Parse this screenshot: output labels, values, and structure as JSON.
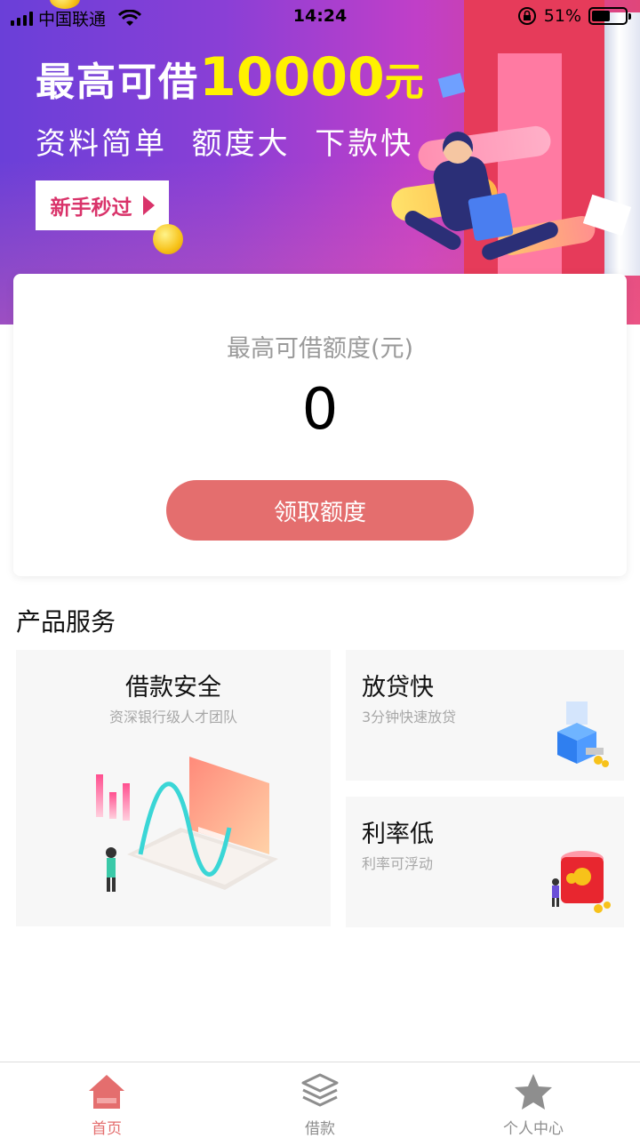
{
  "status_bar": {
    "carrier": "中国联通",
    "time": "14:24",
    "battery": "51%"
  },
  "banner": {
    "title_prefix": "最高可借",
    "title_amount": "10000",
    "title_suffix": "元",
    "subtitle": "资料简单  额度大  下款快",
    "cta_label": "新手秒过"
  },
  "quota_card": {
    "label": "最高可借额度(元)",
    "value": "0",
    "button_label": "领取额度"
  },
  "services": {
    "section_title": "产品服务",
    "items": [
      {
        "title": "借款安全",
        "desc": "资深银行级人才团队"
      },
      {
        "title": "放贷快",
        "desc": "3分钟快速放贷"
      },
      {
        "title": "利率低",
        "desc": "利率可浮动"
      }
    ]
  },
  "tabbar": {
    "items": [
      {
        "label": "首页",
        "icon": "home-icon",
        "active": true
      },
      {
        "label": "借款",
        "icon": "layers-icon",
        "active": false
      },
      {
        "label": "个人中心",
        "icon": "star-icon",
        "active": false
      }
    ],
    "active_color": "#e46e6e",
    "inactive_color": "#8e8e8e"
  },
  "colors": {
    "accent": "#e46e6e",
    "banner_highlight": "#fff200",
    "cta_text": "#d9336a"
  }
}
